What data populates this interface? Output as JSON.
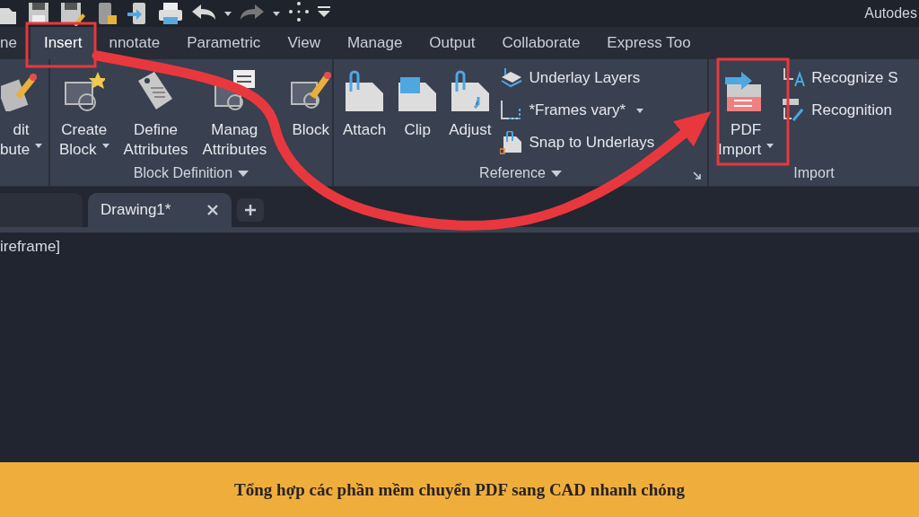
{
  "window": {
    "title": "Autodes"
  },
  "ribbon_tabs": [
    {
      "label": "ne",
      "selected": false
    },
    {
      "label": "Insert",
      "selected": true
    },
    {
      "label": "nnotate",
      "selected": false
    },
    {
      "label": "Parametric",
      "selected": false
    },
    {
      "label": "View",
      "selected": false
    },
    {
      "label": "Manage",
      "selected": false
    },
    {
      "label": "Output",
      "selected": false
    },
    {
      "label": "Collaborate",
      "selected": false
    },
    {
      "label": "Express Too",
      "selected": false
    }
  ],
  "panels": [
    {
      "tools": [
        {
          "kind": "large",
          "lines": [
            "dit",
            "bute"
          ],
          "dropdown": true
        }
      ]
    },
    {
      "title": "Block Definition",
      "menu": true,
      "tools": [
        {
          "kind": "large",
          "lines": [
            "Create",
            "Block"
          ],
          "dropdown": true
        },
        {
          "kind": "large",
          "lines": [
            "Define",
            "Attributes"
          ],
          "dropdown": false
        },
        {
          "kind": "large",
          "lines": [
            "Manag",
            "Attributes"
          ],
          "dropdown": false
        },
        {
          "kind": "large",
          "lines": [
            "Block"
          ],
          "dropdown": false
        }
      ]
    },
    {
      "title": "Reference",
      "menu": true,
      "launcher": true,
      "tools": [
        {
          "kind": "large",
          "lines": [
            "Attach"
          ],
          "dropdown": false
        },
        {
          "kind": "large",
          "lines": [
            "Clip"
          ],
          "dropdown": false
        },
        {
          "kind": "large",
          "lines": [
            "Adjust"
          ],
          "dropdown": false
        },
        {
          "kind": "stack",
          "rows": [
            {
              "label": "Underlay Layers",
              "dropdown": false
            },
            {
              "label": "*Frames vary*",
              "dropdown": true
            },
            {
              "label": "Snap to Underlays",
              "dropdown": false
            }
          ]
        }
      ]
    },
    {
      "title": "Import",
      "menu": false,
      "tools": [
        {
          "kind": "large",
          "lines": [
            "PDF",
            "Import"
          ],
          "dropdown": true
        },
        {
          "kind": "stack",
          "rows": [
            {
              "label": "Recognize S",
              "dropdown": false
            },
            {
              "label": "Recognition",
              "dropdown": false
            }
          ]
        }
      ]
    }
  ],
  "document_tabs": [
    {
      "label": "Drawing1*",
      "selected": true
    }
  ],
  "viewport": {
    "label": "ireframe]"
  },
  "caption": "Tổng hợp các phần mềm chuyển PDF sang CAD nhanh chóng"
}
